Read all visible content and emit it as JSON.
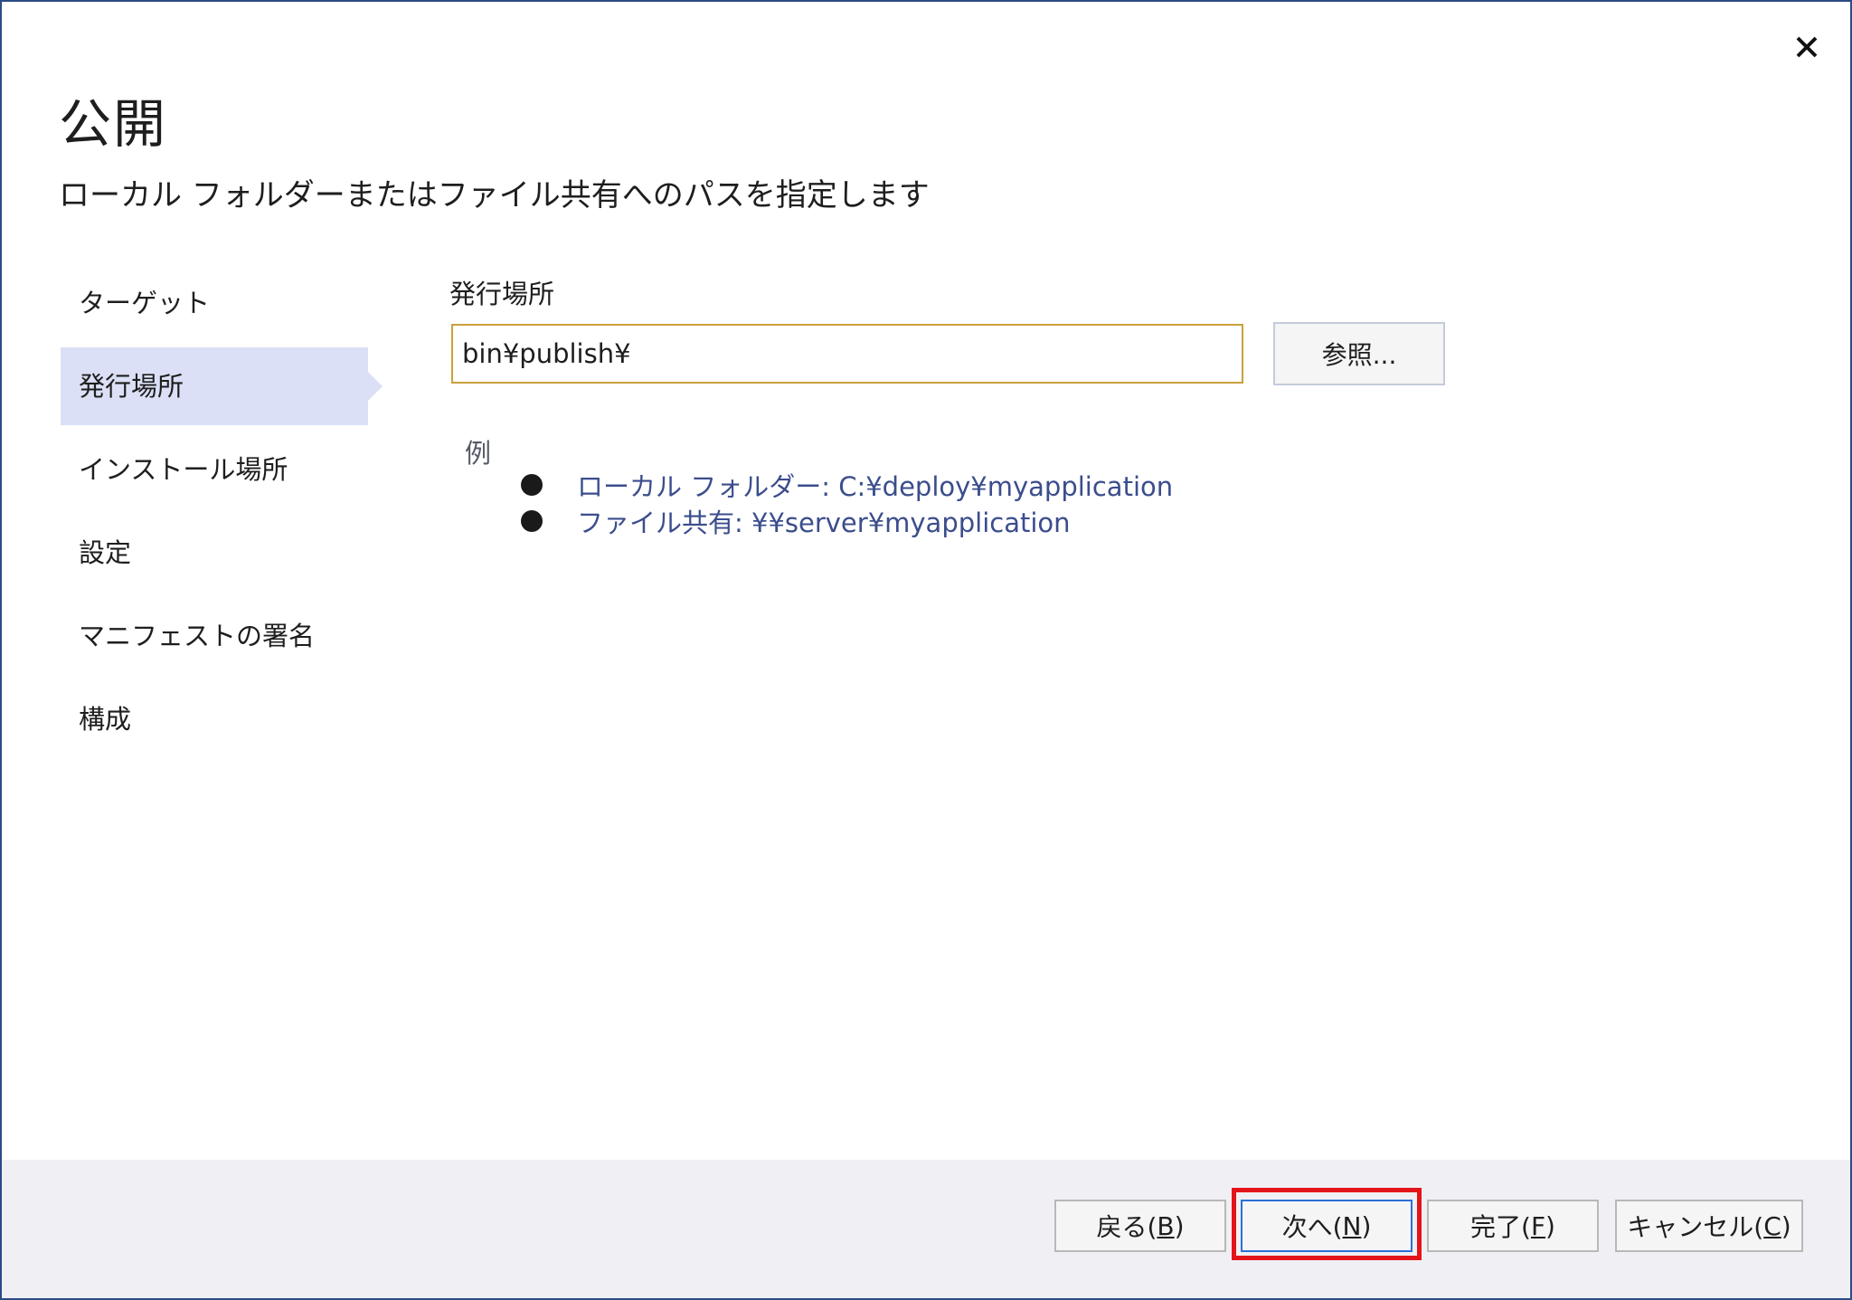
{
  "window": {
    "title": "公開",
    "subtitle": "ローカル フォルダーまたはファイル共有へのパスを指定します",
    "close_icon": "close-icon"
  },
  "nav": {
    "items": [
      {
        "label": "ターゲット",
        "active": false
      },
      {
        "label": "発行場所",
        "active": true
      },
      {
        "label": "インストール場所",
        "active": false
      },
      {
        "label": "設定",
        "active": false
      },
      {
        "label": "マニフェストの署名",
        "active": false
      },
      {
        "label": "構成",
        "active": false
      }
    ]
  },
  "main": {
    "field_label": "発行場所",
    "path_value": "bin¥publish¥",
    "browse_label": "参照...",
    "example_label": "例",
    "examples": [
      "ローカル フォルダー:  C:¥deploy¥myapplication",
      "ファイル共有: ¥¥server¥myapplication"
    ]
  },
  "footer": {
    "back": {
      "text": "戻る(",
      "key": "B",
      "end": ")"
    },
    "next": {
      "text": "次へ(",
      "key": "N",
      "end": ")"
    },
    "finish": {
      "text": "完了(",
      "key": "F",
      "end": ")"
    },
    "cancel": {
      "text": "キャンセル(",
      "key": "C",
      "end": ")"
    }
  },
  "colors": {
    "accent_border": "#2b4b86",
    "active_nav": "#dbe0f6",
    "input_border": "#c8a03c",
    "highlight": "#e3141a",
    "example_text": "#3b4d8c"
  }
}
